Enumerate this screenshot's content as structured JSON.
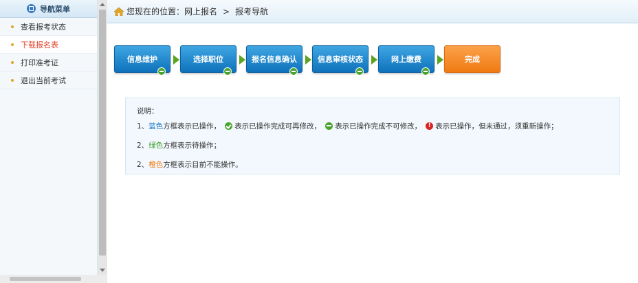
{
  "sidebar": {
    "title": "导航菜单",
    "items": [
      {
        "label": "查看报考状态"
      },
      {
        "label": "下载报名表"
      },
      {
        "label": "打印准考证"
      },
      {
        "label": "退出当前考试"
      }
    ]
  },
  "breadcrumb": {
    "prefix": "您现在的位置：网上报名",
    "separator": ">",
    "current": "报考导航"
  },
  "steps": [
    {
      "label": "信息维护",
      "color": "blue"
    },
    {
      "label": "选择职位",
      "color": "blue"
    },
    {
      "label": "报名信息确认",
      "color": "blue"
    },
    {
      "label": "信息审核状态",
      "color": "blue"
    },
    {
      "label": "网上缴费",
      "color": "blue"
    },
    {
      "label": "完成",
      "color": "orange"
    }
  ],
  "note": {
    "title": "说明：",
    "line1": {
      "num": "1、",
      "blue_word": "蓝色",
      "text_a": "方框表示已操作，",
      "text_b": "表示已操作完成可再修改，",
      "text_c": "表示已操作完成不可修改，",
      "text_d": "表示已操作，但未通过，须重新操作；"
    },
    "line2": {
      "num": "2、",
      "green_word": "绿色",
      "text": "方框表示待操作；"
    },
    "line3": {
      "num": "2、",
      "orange_word": "橙色",
      "text": "方框表示目前不能操作。"
    }
  },
  "colors": {
    "blue": "#1f78c6",
    "green": "#3e9f2a",
    "orange": "#ef7a12",
    "red": "#dd2222"
  }
}
